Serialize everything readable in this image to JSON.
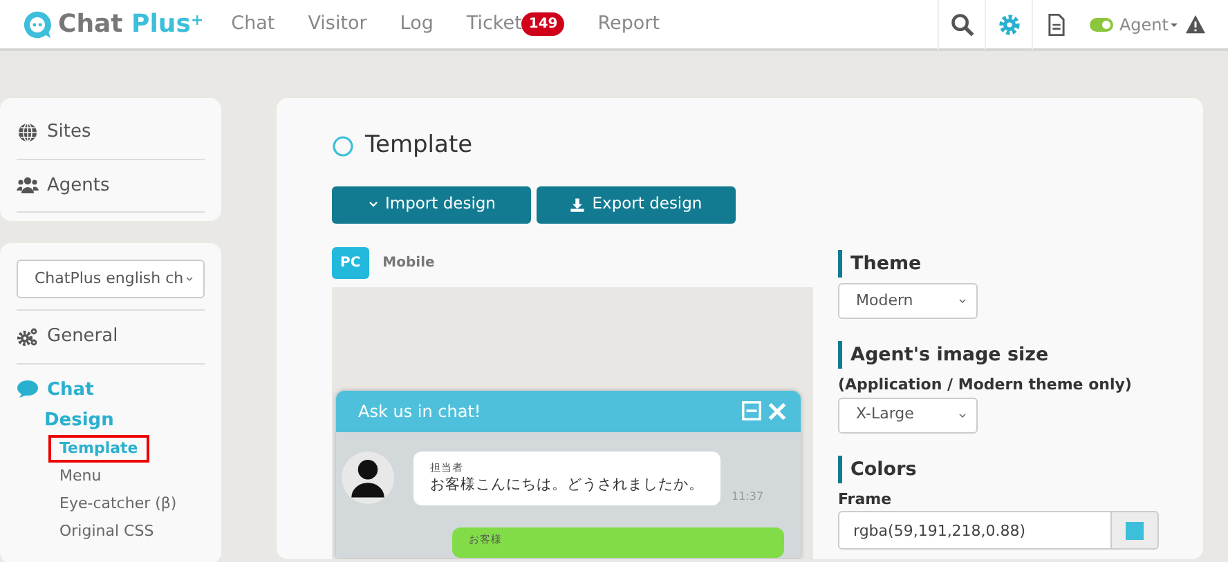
{
  "navbar": {
    "logo": {
      "text": "Chat",
      "accent": "Plus",
      "mark": "+"
    },
    "links": [
      {
        "label": "Chat"
      },
      {
        "label": "Visitor"
      },
      {
        "label": "Log"
      },
      {
        "label": "Ticket",
        "badge": "149"
      },
      {
        "label": "Report"
      }
    ],
    "tools": [
      {
        "kind": "search",
        "selected": false
      },
      {
        "kind": "settings",
        "selected": true
      },
      {
        "kind": "document",
        "selected": false
      }
    ],
    "agent": {
      "label": "Agent",
      "online": true
    }
  },
  "sidebar": {
    "top_items": [
      {
        "kind": "globe",
        "label": "Sites"
      },
      {
        "kind": "users",
        "label": "Agents"
      }
    ],
    "site_select": "ChatPlus english ch",
    "items": [
      {
        "kind": "gears",
        "label": "General",
        "selected": false
      },
      {
        "kind": "chat",
        "label": "Chat",
        "selected": true,
        "children": [
          {
            "label": "Design",
            "selected": true,
            "children": [
              {
                "label": "Template",
                "selected": true
              },
              {
                "label": "Menu",
                "selected": false
              },
              {
                "label": "Eye-catcher (β)",
                "selected": false
              },
              {
                "label": "Original CSS",
                "selected": false
              }
            ]
          }
        ]
      }
    ]
  },
  "main": {
    "title": "Template",
    "buttons": [
      {
        "kind": "import",
        "label": "Import design"
      },
      {
        "kind": "export",
        "label": "Export design"
      }
    ],
    "device_tabs": [
      {
        "label": "PC",
        "selected": true
      },
      {
        "label": "Mobile",
        "selected": false
      }
    ],
    "preview": {
      "header": "Ask us in chat!",
      "messages": [
        {
          "kind": "agent",
          "sender": "担当者",
          "text": "お客様こんにちは。どうされましたか。",
          "time": "11:37"
        },
        {
          "kind": "visitor",
          "sender": "お客様"
        }
      ]
    },
    "settings": {
      "theme": {
        "heading": "Theme",
        "value": "Modern"
      },
      "image_size": {
        "heading": "Agent's image size",
        "note": "(Application / Modern theme only)",
        "value": "X-Large"
      },
      "colors": {
        "heading": "Colors",
        "field_label": "Frame",
        "value": "rgba(59,191,218,0.88)",
        "color": "#3bbfda"
      }
    }
  }
}
